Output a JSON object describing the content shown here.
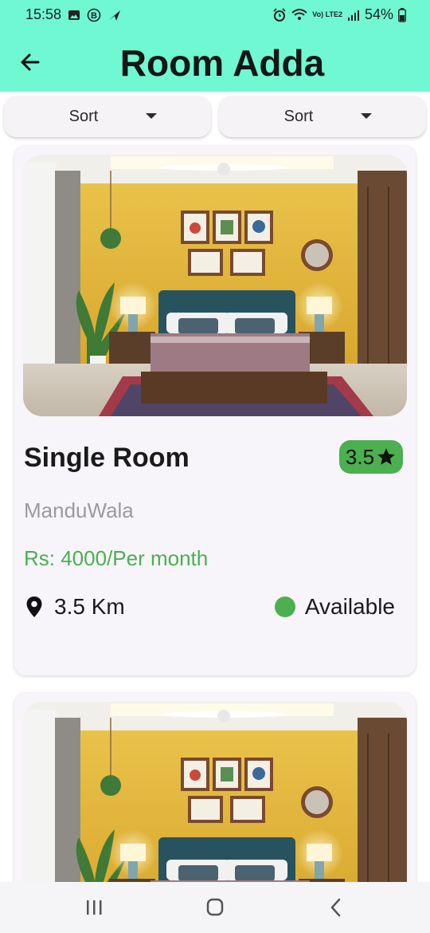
{
  "status_bar": {
    "time": "15:58",
    "battery": "54%",
    "network_label": "Vo) LTE2",
    "left_icons": [
      "image-icon",
      "b-badge-icon",
      "send-icon"
    ],
    "right_icons": [
      "alarm-icon",
      "wifi-icon",
      "signal-icon",
      "battery-icon"
    ]
  },
  "app_bar": {
    "title": "Room Adda",
    "back_icon": "arrow-back-icon",
    "background_color": "#6ff8d2"
  },
  "sort_buttons": [
    {
      "label": "Sort",
      "icon": "caret-down-icon"
    },
    {
      "label": "Sort",
      "icon": "caret-down-icon"
    }
  ],
  "listings": [
    {
      "name": "Single Room",
      "rating": "3.5",
      "location": "ManduWala",
      "price": "Rs: 4000/Per month",
      "distance": "3.5 Km",
      "status": "Available",
      "status_color": "#4caf50",
      "image": "bedroom-photo"
    },
    {
      "image": "bedroom-photo"
    }
  ],
  "nav_bar": {
    "icons": [
      "recent-apps-icon",
      "home-icon",
      "back-icon"
    ]
  }
}
